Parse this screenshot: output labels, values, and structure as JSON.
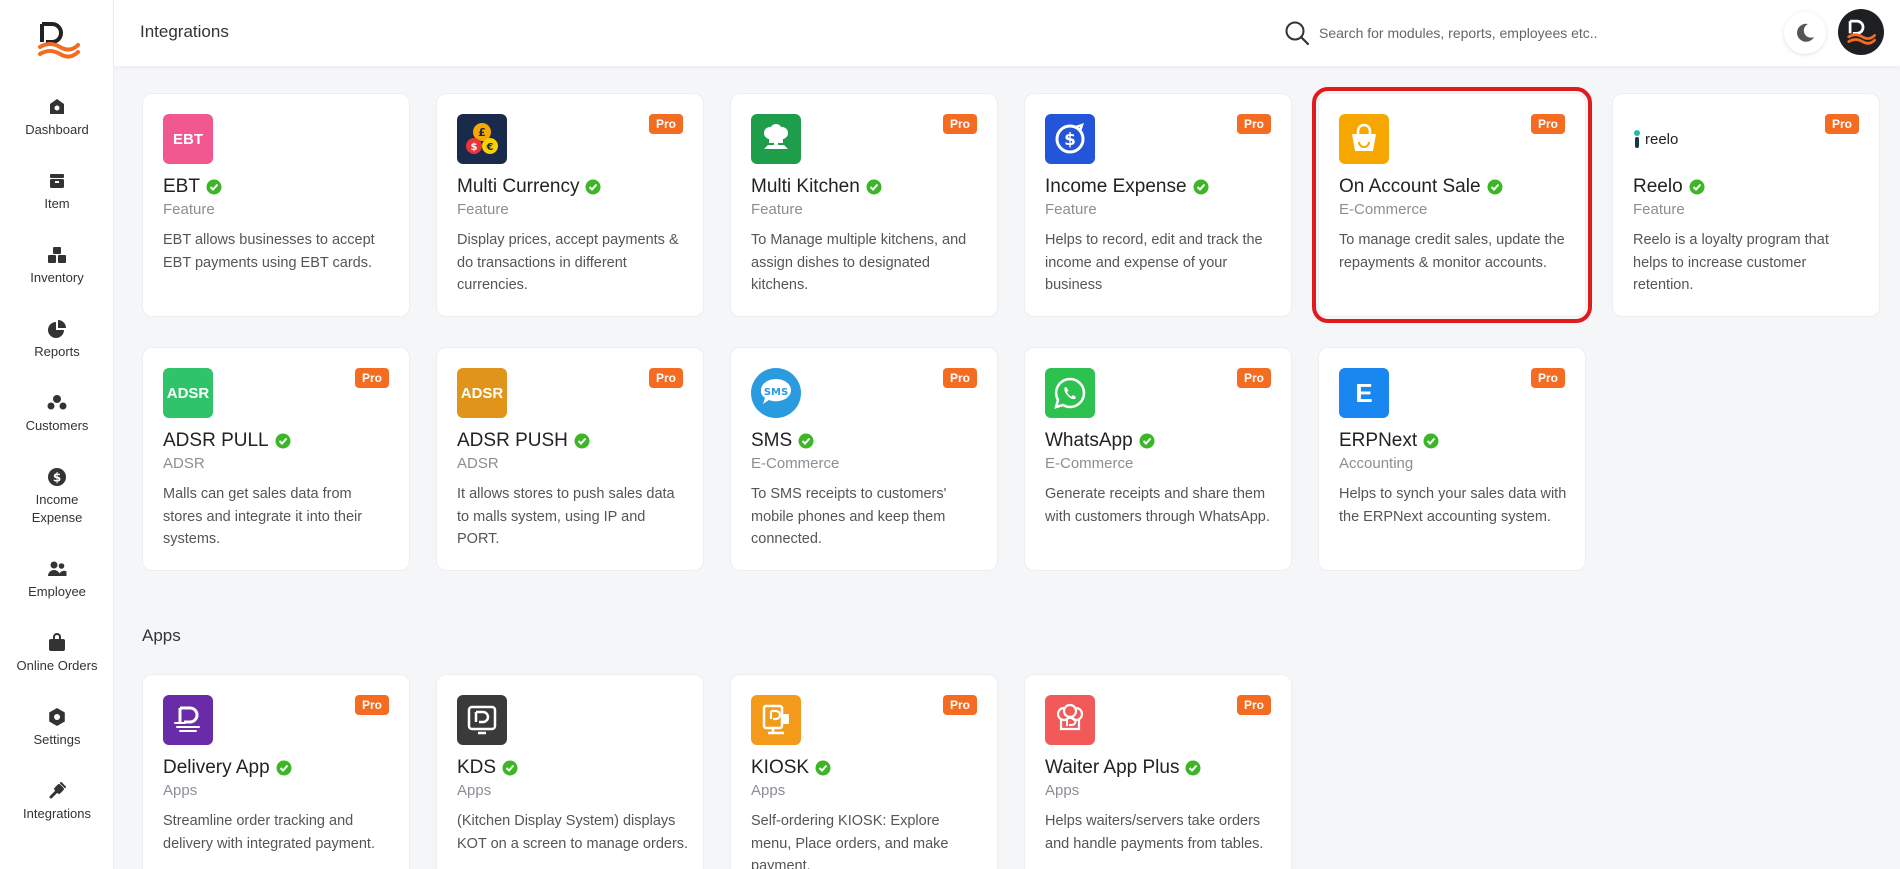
{
  "page_title": "Integrations",
  "search": {
    "placeholder": "Search for modules, reports, employees etc.."
  },
  "sidebar": {
    "items": [
      {
        "label": "Dashboard",
        "icon": "dashboard-icon"
      },
      {
        "label": "Item",
        "icon": "item-icon"
      },
      {
        "label": "Inventory",
        "icon": "inventory-icon"
      },
      {
        "label": "Reports",
        "icon": "reports-icon"
      },
      {
        "label": "Customers",
        "icon": "customers-icon"
      },
      {
        "label": "Income Expense",
        "icon": "income-expense-icon"
      },
      {
        "label": "Employee",
        "icon": "employee-icon"
      },
      {
        "label": "Online Orders",
        "icon": "online-orders-icon"
      },
      {
        "label": "Settings",
        "icon": "settings-icon"
      },
      {
        "label": "Integrations",
        "icon": "integrations-icon"
      }
    ]
  },
  "cards": [
    {
      "title": "EBT",
      "category": "Feature",
      "description": "EBT allows businesses to accept EBT payments using EBT cards.",
      "pro": false,
      "icon_text": "EBT",
      "icon_color": "#f0588f"
    },
    {
      "title": "Multi Currency",
      "category": "Feature",
      "description": "Display prices, accept payments & do transactions in different currencies.",
      "pro": true,
      "icon_text": "",
      "icon_color": "#1a2a4a"
    },
    {
      "title": "Multi Kitchen",
      "category": "Feature",
      "description": "To Manage multiple kitchens, and assign dishes to designated kitchens.",
      "pro": true,
      "icon_text": "",
      "icon_color": "#1e9e4a"
    },
    {
      "title": "Income Expense",
      "category": "Feature",
      "description": "Helps to record, edit and track the income and expense of your business",
      "pro": true,
      "icon_text": "",
      "icon_color": "#2255d8"
    },
    {
      "title": "On Account Sale",
      "category": "E-Commerce",
      "description": "To manage credit sales, update the repayments & monitor accounts.",
      "pro": true,
      "icon_text": "",
      "icon_color": "#f7a800"
    },
    {
      "title": "Reelo",
      "category": "Feature",
      "description": "Reelo is a loyalty program that helps to increase customer retention.",
      "pro": true,
      "icon_text": "reelo",
      "icon_color": "#ffffff"
    },
    {
      "title": "ADSR PULL",
      "category": "ADSR",
      "description": "Malls can get sales data from stores and integrate it into their systems.",
      "pro": true,
      "icon_text": "ADSR",
      "icon_color": "#2fc46a"
    },
    {
      "title": "ADSR PUSH",
      "category": "ADSR",
      "description": "It allows stores to push sales data to malls system, using IP and PORT.",
      "pro": true,
      "icon_text": "ADSR",
      "icon_color": "#e0941a"
    },
    {
      "title": "SMS",
      "category": "E-Commerce",
      "description": "To SMS receipts to customers' mobile phones and keep them connected.",
      "pro": true,
      "icon_text": "SMS",
      "icon_color": "#2b9be0"
    },
    {
      "title": "WhatsApp",
      "category": "E-Commerce",
      "description": "Generate receipts and share them with customers through WhatsApp.",
      "pro": true,
      "icon_text": "",
      "icon_color": "#2dc24f"
    },
    {
      "title": "ERPNext",
      "category": "Accounting",
      "description": "Helps to synch your sales data with the ERPNext accounting system.",
      "pro": true,
      "icon_text": "E",
      "icon_color": "#1a86f0"
    }
  ],
  "apps_section": {
    "title": "Apps",
    "cards": [
      {
        "title": "Delivery App",
        "category": "Apps",
        "description": "Streamline order tracking and delivery with integrated payment.",
        "pro": true,
        "icon_color": "#6a2ba8"
      },
      {
        "title": "KDS",
        "category": "Apps",
        "description": "(Kitchen Display System) displays KOT on a screen to manage orders.",
        "pro": false,
        "icon_color": "#3a3a3a"
      },
      {
        "title": "KIOSK",
        "category": "Apps",
        "description": "Self-ordering KIOSK: Explore menu, Place orders, and make payment.",
        "pro": true,
        "icon_color": "#f39a1a"
      },
      {
        "title": "Waiter App Plus",
        "category": "Apps",
        "description": "Helps waiters/servers take orders and handle payments from tables.",
        "pro": true,
        "icon_color": "#f25a5a"
      }
    ]
  },
  "pro_label": "Pro",
  "colors": {
    "accent": "#f36c21",
    "check": "#3cb527",
    "highlight": "#e01b1b"
  }
}
